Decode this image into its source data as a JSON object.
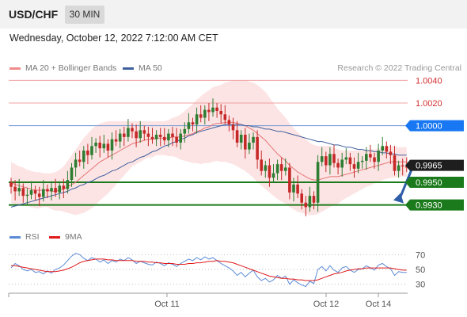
{
  "header": {
    "pair": "USD/CHF",
    "timeframe": "30 MIN"
  },
  "date_line": "Wednesday, October 12, 2022 7:12:00 AM CET",
  "legend": {
    "ma_bb": "MA 20 + Bollinger Bands",
    "ma50": "MA 50",
    "copyright": "Research © 2022 Trading Central",
    "rsi": "RSI",
    "ma9": "9MA"
  },
  "colors": {
    "bull": "#2e7d32",
    "bear": "#c62828",
    "bands_fill": "#fde4e4",
    "ma20": "#e57373",
    "ma50": "#3f5f9e",
    "support": "#1b7a1b",
    "pivot": "#1877f2",
    "rsi": "#5b8bd6",
    "rsi_ma": "#e0191b"
  },
  "chart_data": [
    {
      "type": "candlestick",
      "title": "",
      "x_tick_labels": [
        "Oct 11",
        "Oct 12",
        "Oct 14"
      ],
      "ylim": [
        0.9915,
        1.0048
      ],
      "levels": [
        {
          "value": 1.004,
          "label": "1.0040",
          "kind": "resistance"
        },
        {
          "value": 1.002,
          "label": "1.0020",
          "kind": "resistance"
        },
        {
          "value": 1.0,
          "label": "1.0000",
          "kind": "pivot"
        },
        {
          "value": 0.995,
          "label": "0.9950",
          "kind": "support"
        },
        {
          "value": 0.993,
          "label": "0.9930",
          "kind": "support"
        }
      ],
      "last_price": {
        "value": 0.9965,
        "label": "0.9965"
      },
      "forecast_arrow": {
        "from": 0.9965,
        "to": 0.993,
        "direction": "down"
      },
      "close": [
        0.9946,
        0.9942,
        0.9945,
        0.9938,
        0.9939,
        0.9943,
        0.994,
        0.9937,
        0.9944,
        0.9942,
        0.9945,
        0.9941,
        0.9947,
        0.9944,
        0.9952,
        0.9963,
        0.997,
        0.9968,
        0.9978,
        0.9974,
        0.9982,
        0.9985,
        0.998,
        0.9984,
        0.9978,
        0.9988,
        0.9986,
        0.9993,
        0.999,
        0.9998,
        0.9995,
        0.9989,
        0.9996,
        0.9993,
        0.999,
        0.9988,
        0.9992,
        0.999,
        0.9987,
        0.9993,
        0.999,
        0.9985,
        0.9993,
        0.9997,
        1.0003,
        1.0001,
        1.001,
        1.0007,
        1.0014,
        1.0012,
        1.0016,
        1.0013,
        1.001,
        1.0005,
        1.0001,
        0.9996,
        0.9985,
        0.9992,
        0.9979,
        0.9985,
        0.999,
        0.997,
        0.996,
        0.9965,
        0.9954,
        0.9958,
        0.9966,
        0.996,
        0.9963,
        0.9941,
        0.9948,
        0.994,
        0.9932,
        0.9928,
        0.9938,
        0.9932,
        0.9968,
        0.9973,
        0.9965,
        0.9975,
        0.9967,
        0.9963,
        0.997,
        0.9972,
        0.9966,
        0.9962,
        0.9968,
        0.9969,
        0.9975,
        0.9972,
        0.9968,
        0.9978,
        0.9982,
        0.9977,
        0.9974,
        0.996,
        0.9965,
        0.9964,
        0.9963
      ],
      "ma20": [
        0.995,
        0.9948,
        0.9947,
        0.9946,
        0.9945,
        0.9944,
        0.9943,
        0.9943,
        0.9943,
        0.9943,
        0.9942,
        0.9942,
        0.9943,
        0.9944,
        0.9946,
        0.9948,
        0.995,
        0.9953,
        0.9956,
        0.9959,
        0.9962,
        0.9965,
        0.9968,
        0.997,
        0.9972,
        0.9974,
        0.9976,
        0.9978,
        0.998,
        0.9982,
        0.9984,
        0.9985,
        0.9986,
        0.9987,
        0.9988,
        0.9988,
        0.9989,
        0.9989,
        0.9989,
        0.9989,
        0.999,
        0.999,
        0.999,
        0.9991,
        0.9992,
        0.9993,
        0.9995,
        0.9996,
        0.9998,
        0.9999,
        1.0001,
        1.0002,
        1.0002,
        1.0003,
        1.0003,
        1.0003,
        1.0002,
        1.0001,
        1.0,
        0.9998,
        0.9996,
        0.9993,
        0.999,
        0.9987,
        0.9983,
        0.9979,
        0.9975,
        0.9972,
        0.9969,
        0.9965,
        0.9962,
        0.9959,
        0.9957,
        0.9955,
        0.9953,
        0.9952,
        0.9952,
        0.9953,
        0.9954,
        0.9955,
        0.9955,
        0.9955,
        0.9956,
        0.9957,
        0.9958,
        0.9959,
        0.996,
        0.9961,
        0.9962,
        0.9963,
        0.9964,
        0.9965,
        0.9966,
        0.9967,
        0.9968,
        0.9968,
        0.9968,
        0.9968,
        0.9968
      ],
      "ma50": [
        0.9928,
        0.9929,
        0.993,
        0.9931,
        0.9932,
        0.9933,
        0.9934,
        0.9935,
        0.9936,
        0.9937,
        0.9938,
        0.9939,
        0.994,
        0.9941,
        0.9942,
        0.9944,
        0.9945,
        0.9947,
        0.9948,
        0.995,
        0.9951,
        0.9953,
        0.9955,
        0.9956,
        0.9958,
        0.996,
        0.9961,
        0.9963,
        0.9965,
        0.9967,
        0.9968,
        0.997,
        0.9972,
        0.9973,
        0.9975,
        0.9977,
        0.9978,
        0.998,
        0.9982,
        0.9983,
        0.9985,
        0.9986,
        0.9988,
        0.9989,
        0.9991,
        0.9992,
        0.9994,
        0.9995,
        0.9996,
        0.9997,
        0.9998,
        0.9999,
        1.0,
        1.0001,
        1.0001,
        1.0001,
        1.0001,
        1.0001,
        1.0,
        1.0,
        0.9999,
        0.9999,
        0.9998,
        0.9997,
        0.9997,
        0.9996,
        0.9995,
        0.9995,
        0.9994,
        0.9993,
        0.9992,
        0.9991,
        0.999,
        0.9989,
        0.9988,
        0.9987,
        0.9986,
        0.9986,
        0.9985,
        0.9984,
        0.9983,
        0.9983,
        0.9982,
        0.9981,
        0.9981,
        0.998,
        0.9979,
        0.9979,
        0.9978,
        0.9978,
        0.9977,
        0.9977,
        0.9976,
        0.9976,
        0.9975,
        0.9975,
        0.9974,
        0.9974,
        0.9974
      ],
      "band_width": [
        0.0018,
        0.0018,
        0.0017,
        0.0017,
        0.0016,
        0.0016,
        0.0016,
        0.0016,
        0.0015,
        0.0015,
        0.0016,
        0.0017,
        0.0018,
        0.002,
        0.0023,
        0.0026,
        0.0029,
        0.0031,
        0.0033,
        0.0034,
        0.0035,
        0.0035,
        0.0034,
        0.0033,
        0.0032,
        0.003,
        0.0028,
        0.0026,
        0.0024,
        0.0022,
        0.002,
        0.0019,
        0.0018,
        0.0017,
        0.0016,
        0.0016,
        0.0015,
        0.0015,
        0.0015,
        0.0016,
        0.0017,
        0.0018,
        0.002,
        0.0022,
        0.0024,
        0.0026,
        0.0028,
        0.003,
        0.0031,
        0.0032,
        0.0033,
        0.0033,
        0.0034,
        0.0035,
        0.0036,
        0.0037,
        0.0038,
        0.0039,
        0.004,
        0.0041,
        0.0042,
        0.0043,
        0.0043,
        0.0043,
        0.0042,
        0.0041,
        0.004,
        0.0039,
        0.0038,
        0.0037,
        0.0036,
        0.0035,
        0.0034,
        0.0033,
        0.0032,
        0.0031,
        0.003,
        0.0029,
        0.0028,
        0.0027,
        0.0025,
        0.0024,
        0.0022,
        0.0021,
        0.002,
        0.0019,
        0.0018,
        0.0017,
        0.0016,
        0.0016,
        0.0015,
        0.0015,
        0.0014,
        0.0014,
        0.0014,
        0.0014,
        0.0013,
        0.0013,
        0.0013
      ]
    },
    {
      "type": "line",
      "series": [
        {
          "name": "RSI"
        },
        {
          "name": "9MA"
        }
      ],
      "y_tick_labels": [
        "70",
        "50",
        "30"
      ],
      "ylim": [
        20,
        80
      ],
      "rsi": [
        52,
        58,
        55,
        50,
        48,
        50,
        46,
        47,
        44,
        48,
        45,
        50,
        52,
        56,
        62,
        68,
        72,
        70,
        65,
        62,
        66,
        64,
        60,
        63,
        58,
        62,
        60,
        64,
        62,
        66,
        63,
        58,
        61,
        59,
        57,
        56,
        60,
        58,
        55,
        59,
        57,
        54,
        58,
        61,
        64,
        62,
        66,
        63,
        67,
        64,
        66,
        62,
        58,
        55,
        52,
        48,
        42,
        46,
        40,
        45,
        49,
        40,
        35,
        38,
        33,
        36,
        42,
        38,
        41,
        30,
        36,
        32,
        29,
        27,
        34,
        31,
        50,
        54,
        48,
        55,
        49,
        46,
        52,
        54,
        49,
        46,
        50,
        51,
        55,
        52,
        49,
        56,
        58,
        54,
        51,
        42,
        47,
        46,
        46
      ],
      "rsi_ma": [
        55,
        55,
        54,
        53,
        52,
        51,
        50,
        49,
        48,
        47,
        47,
        47,
        48,
        49,
        51,
        53,
        56,
        59,
        61,
        62,
        63,
        64,
        64,
        64,
        63,
        63,
        62,
        62,
        62,
        62,
        62,
        61,
        61,
        61,
        60,
        60,
        59,
        59,
        58,
        58,
        58,
        57,
        57,
        57,
        58,
        58,
        59,
        59,
        60,
        61,
        61,
        62,
        61,
        61,
        60,
        59,
        57,
        55,
        53,
        51,
        49,
        47,
        45,
        43,
        41,
        40,
        39,
        38,
        38,
        37,
        37,
        36,
        36,
        35,
        35,
        35,
        36,
        38,
        40,
        42,
        44,
        45,
        46,
        48,
        49,
        50,
        51,
        51,
        52,
        52,
        52,
        52,
        52,
        52,
        52,
        51,
        50,
        49,
        49
      ]
    }
  ]
}
